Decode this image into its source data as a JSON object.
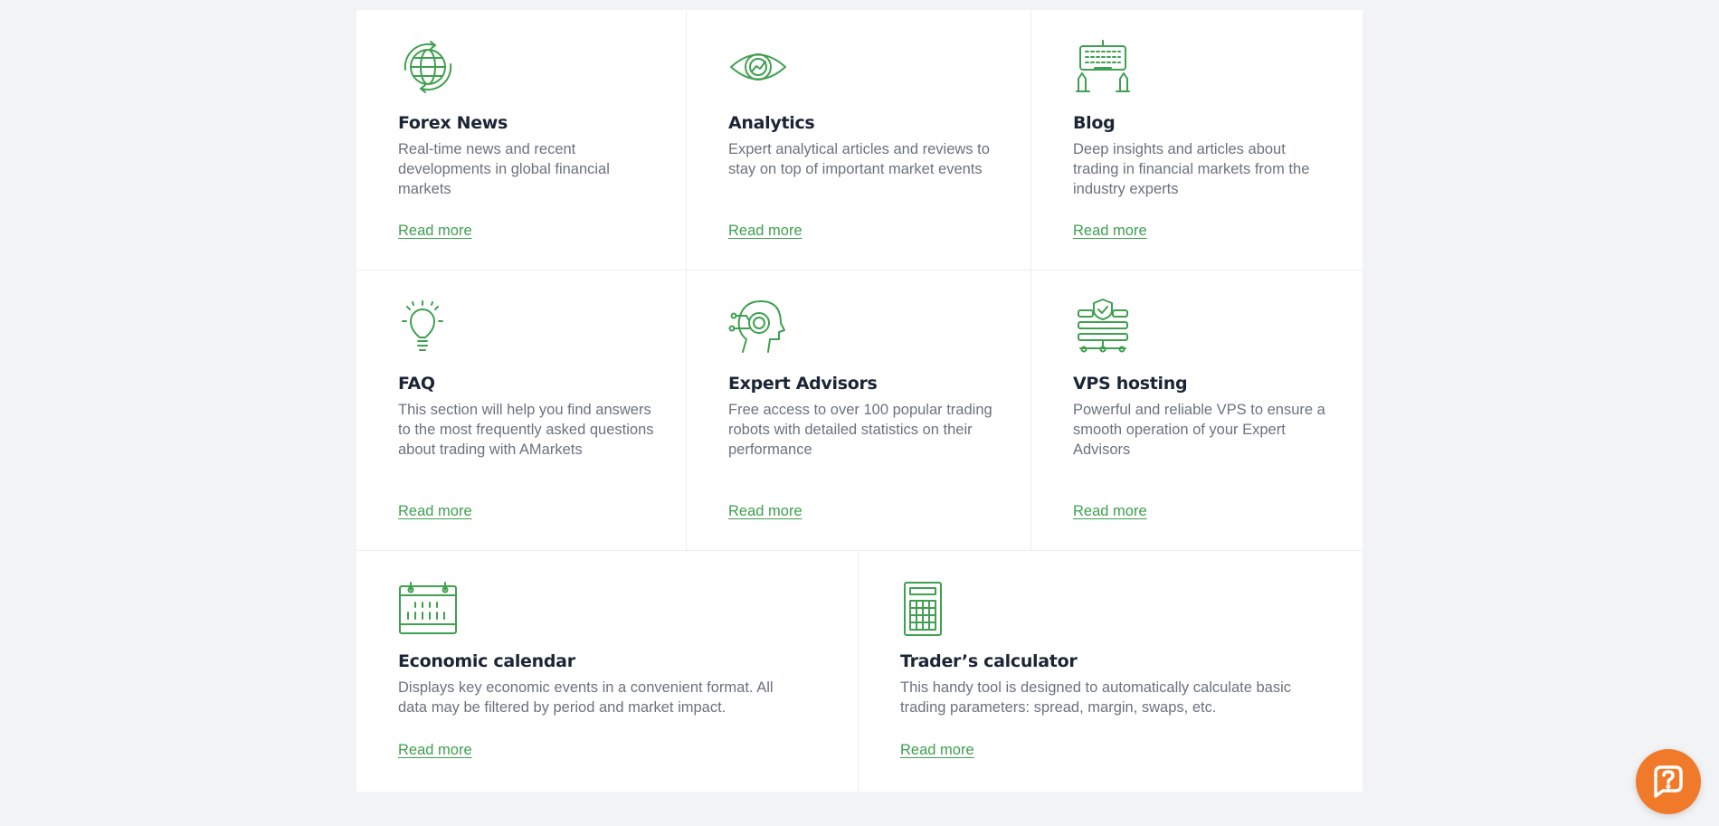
{
  "cards": [
    {
      "icon": "globe-icon",
      "title": "Forex News",
      "text": "Real-time news and recent developments in global financial markets",
      "link": "Read more"
    },
    {
      "icon": "eye-icon",
      "title": "Analytics",
      "text": "Expert analytical articles and reviews to stay on top of important market events",
      "link": "Read more"
    },
    {
      "icon": "keyboard-hands-icon",
      "title": "Blog",
      "text": "Deep insights and articles about trading in financial markets from the industry experts",
      "link": "Read more"
    },
    {
      "icon": "lightbulb-icon",
      "title": "FAQ",
      "text": "This section will help you find answers to the most frequently asked questions about trading with AMarkets",
      "link": "Read more"
    },
    {
      "icon": "robot-head-icon",
      "title": "Expert Advisors",
      "text": "Free access to over 100 popular trading robots with detailed statistics on their performance",
      "link": "Read more"
    },
    {
      "icon": "server-shield-icon",
      "title": "VPS hosting",
      "text": "Powerful and reliable VPS to ensure a smooth operation of your Expert Advisors",
      "link": "Read more"
    },
    {
      "icon": "calendar-icon",
      "title": "Economic calendar",
      "text": "Displays key economic events in a convenient format. All data may be filtered by period and market impact.",
      "link": "Read more"
    },
    {
      "icon": "calculator-icon",
      "title": "Trader’s calculator",
      "text": "This handy tool is designed to automatically calculate basic trading parameters: spread, margin, swaps, etc.",
      "link": "Read more"
    }
  ],
  "support_button": {
    "icon": "question-mark-icon"
  },
  "colors": {
    "accent": "#3fa04f",
    "heading": "#1c2536",
    "body_text": "#6c727c",
    "background": "#f2f3f5",
    "support_button": "#f07a2a"
  }
}
